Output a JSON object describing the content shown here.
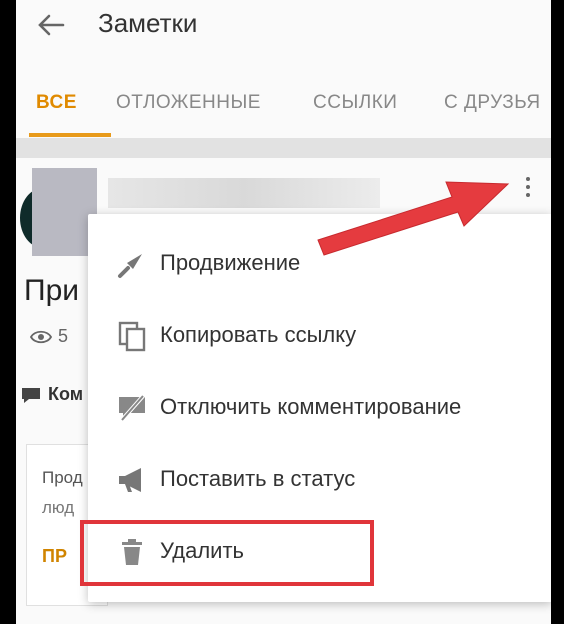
{
  "header": {
    "title": "Заметки"
  },
  "tabs": [
    {
      "label": "ВСЕ",
      "active": true
    },
    {
      "label": "ОТЛОЖЕННЫЕ"
    },
    {
      "label": "ССЫЛКИ"
    },
    {
      "label": "С ДРУЗЬЯ"
    }
  ],
  "post": {
    "title_partial": "При",
    "views": "5",
    "comments_partial": "Ком",
    "inner_text_line1": "Прод",
    "inner_text_line2": "люд",
    "inner_button_partial": "ПР"
  },
  "menu": {
    "items": [
      {
        "label": "Продвижение",
        "icon": "promote-arrow-icon"
      },
      {
        "label": "Копировать ссылку",
        "icon": "copy-icon"
      },
      {
        "label": "Отключить комментирование",
        "icon": "comments-off-icon"
      },
      {
        "label": "Поставить в статус",
        "icon": "megaphone-icon"
      },
      {
        "label": "Удалить",
        "icon": "trash-icon"
      }
    ]
  },
  "colors": {
    "accent": "#e08a00",
    "highlight": "#e0353a",
    "arrow": "#e53b3f"
  }
}
